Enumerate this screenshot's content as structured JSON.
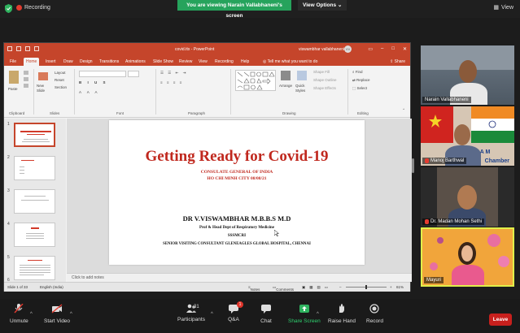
{
  "topbar": {
    "recording_label": "Recording",
    "banner_text": "You are viewing Narain Vallabhaneni's screen",
    "view_options_label": "View Options",
    "view_label": "View"
  },
  "ppt": {
    "doc_title": "covid.ttx  -  PowerPoint",
    "user_name": "viswambhar vallabhaneni",
    "user_initials": "VV",
    "tabs": [
      "File",
      "Home",
      "Insert",
      "Draw",
      "Design",
      "Transitions",
      "Animations",
      "Slide Show",
      "Review",
      "View",
      "Recording",
      "Help"
    ],
    "active_tab": "Home",
    "tell_me": "Tell me what you want to do",
    "share_label": "Share",
    "ribbon_groups": {
      "clipboard": "Clipboard",
      "slides": "Slides",
      "font": "Font",
      "paragraph": "Paragraph",
      "drawing": "Drawing",
      "editing": "Editing"
    },
    "ribbon_buttons": {
      "paste": "Paste",
      "new_slide": "New Slide",
      "layout": "Layout",
      "reset": "Reset",
      "section": "Section",
      "arrange": "Arrange",
      "quick_styles": "Quick Styles",
      "shape_fill": "Shape Fill",
      "shape_outline": "Shape Outline",
      "shape_effects": "Shape Effects",
      "find": "Find",
      "replace": "Replace",
      "select": "Select"
    },
    "thumb_numbers": [
      "1",
      "2",
      "3",
      "4",
      "5",
      "6"
    ],
    "slide": {
      "title": "Getting Ready for Covid-19",
      "subtitle1": "CONSULATE GENERAL OF INDIA",
      "subtitle2": "HO CHI MINH CITY     08/08/21",
      "presenter": "DR V.VISWAMBHAR M.B.B.S M.D",
      "role": "Prof & Head Dept of Respiratory Medicine",
      "institution": "SSSMCRI",
      "consultant": "SENIOR VISITING CONSULTANT GLENEAGLES GLOBAL HOSPITAL, CHENNAI"
    },
    "notes_placeholder": "Click to add notes",
    "status": {
      "slide_count": "Slide 1 of 33",
      "language": "English (India)",
      "notes": "Notes",
      "comments": "Comments",
      "zoom": "61%"
    }
  },
  "participants": [
    {
      "name": "Narain Vallabhaneni",
      "muted": false
    },
    {
      "name": "Manoj Barthwal",
      "muted": true,
      "caption": "Chamber"
    },
    {
      "name": "Dr. Madan Mohan Sethi",
      "muted": true
    },
    {
      "name": "Mayuri",
      "muted": false
    }
  ],
  "controls": {
    "unmute": "Unmute",
    "start_video": "Start Video",
    "participants": "Participants",
    "participants_count": "31",
    "qa": "Q&A",
    "qa_badge": "1",
    "chat": "Chat",
    "share_screen": "Share Screen",
    "raise_hand": "Raise Hand",
    "record": "Record",
    "leave": "Leave"
  },
  "colors": {
    "ppt_accent": "#c5452b",
    "banner_green": "#26a35c",
    "leave_red": "#c8201d",
    "slide_title_red": "#c0281e"
  }
}
